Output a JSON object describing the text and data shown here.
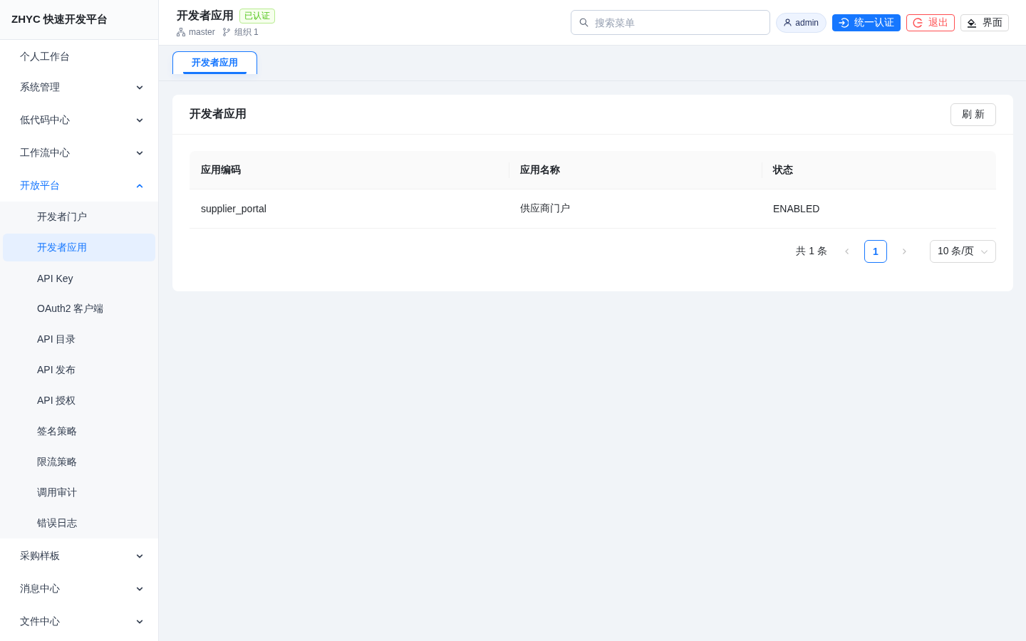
{
  "sidebar": {
    "brand": "ZHYC 快速开发平台",
    "items": [
      {
        "label": "个人工作台",
        "kind": "link",
        "selected": false
      },
      {
        "label": "系统管理",
        "kind": "group",
        "selected": false,
        "expanded": false
      },
      {
        "label": "低代码中心",
        "kind": "group",
        "selected": false,
        "expanded": false
      },
      {
        "label": "工作流中心",
        "kind": "group",
        "selected": false,
        "expanded": false
      },
      {
        "label": "开放平台",
        "kind": "group",
        "selected": true,
        "expanded": true,
        "children": [
          {
            "label": "开发者门户",
            "selected": false
          },
          {
            "label": "开发者应用",
            "selected": true
          },
          {
            "label": "API Key",
            "selected": false
          },
          {
            "label": "OAuth2 客户端",
            "selected": false
          },
          {
            "label": "API 目录",
            "selected": false
          },
          {
            "label": "API 发布",
            "selected": false
          },
          {
            "label": "API 授权",
            "selected": false
          },
          {
            "label": "签名策略",
            "selected": false
          },
          {
            "label": "限流策略",
            "selected": false
          },
          {
            "label": "调用审计",
            "selected": false
          },
          {
            "label": "错误日志",
            "selected": false
          }
        ]
      },
      {
        "label": "采购样板",
        "kind": "group",
        "selected": false,
        "expanded": false
      },
      {
        "label": "消息中心",
        "kind": "group",
        "selected": false,
        "expanded": false
      },
      {
        "label": "文件中心",
        "kind": "group",
        "selected": false,
        "expanded": false
      }
    ]
  },
  "header": {
    "title": "开发者应用",
    "badge": "已认证",
    "workspace": "master",
    "organization": "组织 1",
    "search": {
      "placeholder": "搜索菜单"
    },
    "user": "admin",
    "buttons": [
      {
        "label": "统一认证",
        "kind": "primary"
      },
      {
        "label": "退出",
        "kind": "danger"
      },
      {
        "label": "界面",
        "kind": "default"
      }
    ]
  },
  "tabs": [
    {
      "label": "开发者应用",
      "selected": true
    }
  ],
  "card": {
    "title": "开发者应用",
    "button": "刷 新",
    "table": {
      "columns": [
        "应用编码",
        "应用名称",
        "状态"
      ],
      "rows": [
        [
          "supplier_portal",
          "供应商门户",
          "ENABLED"
        ]
      ]
    },
    "pagination": {
      "total": "共 1 条",
      "prev": {
        "disabled": true
      },
      "pages": [
        {
          "label": "1",
          "selected": true
        }
      ],
      "next": {
        "disabled": true
      },
      "page_size": "10 条/页"
    }
  }
}
